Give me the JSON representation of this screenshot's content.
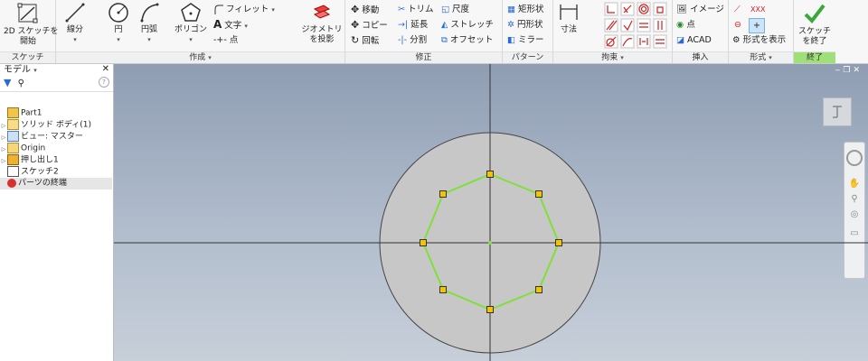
{
  "ribbon": {
    "sketch_panel": {
      "title": "スケッチ",
      "start_2d_label": "2D スケッチを\n開始"
    },
    "create_panel": {
      "title": "作成",
      "line": "線分",
      "circle": "円",
      "arc": "円弧",
      "polygon": "ポリゴン",
      "fillet": "フィレット",
      "text": "文字",
      "point": "点"
    },
    "project_geometry": "ジオメトリ\nを投影",
    "modify_panel": {
      "title": "修正",
      "move": "移動",
      "copy": "コピー",
      "rotate": "回転",
      "trim": "トリム",
      "extend": "延長",
      "split": "分割",
      "scale": "尺度",
      "stretch": "ストレッチ",
      "offset": "オフセット"
    },
    "pattern_panel": {
      "title": "パターン",
      "rectangular": "矩形状",
      "circular": "円形状",
      "mirror": "ミラー"
    },
    "constrain_panel": {
      "title": "拘束",
      "dimension": "寸法"
    },
    "insert_panel": {
      "title": "挿入",
      "image": "イメージ",
      "point": "点",
      "acad": "ACAD"
    },
    "format_panel": {
      "title": "形式",
      "show_format": "形式を表示"
    },
    "exit_panel": {
      "title": "終了",
      "finish_sketch": "スケッチ\nを終了",
      "accent": "#9fe07a"
    }
  },
  "browser": {
    "title": "モデル",
    "tree": [
      {
        "label": "Part1",
        "icon": "part-icon"
      },
      {
        "label": "ソリッド ボディ(1)",
        "icon": "solid-body-icon"
      },
      {
        "label": "ビュー: マスター",
        "icon": "view-icon"
      },
      {
        "label": "Origin",
        "icon": "folder-icon"
      },
      {
        "label": "押し出し1",
        "icon": "extrude-icon"
      },
      {
        "label": "スケッチ2",
        "icon": "sketch-icon"
      },
      {
        "label": "パーツの終端",
        "icon": "end-of-part-icon"
      }
    ]
  },
  "colors": {
    "accent_green": "#9fe07a",
    "polygon_line": "#7fe03a",
    "vertex_fill": "#f5c400",
    "circle_fill": "#c7c7c7"
  }
}
